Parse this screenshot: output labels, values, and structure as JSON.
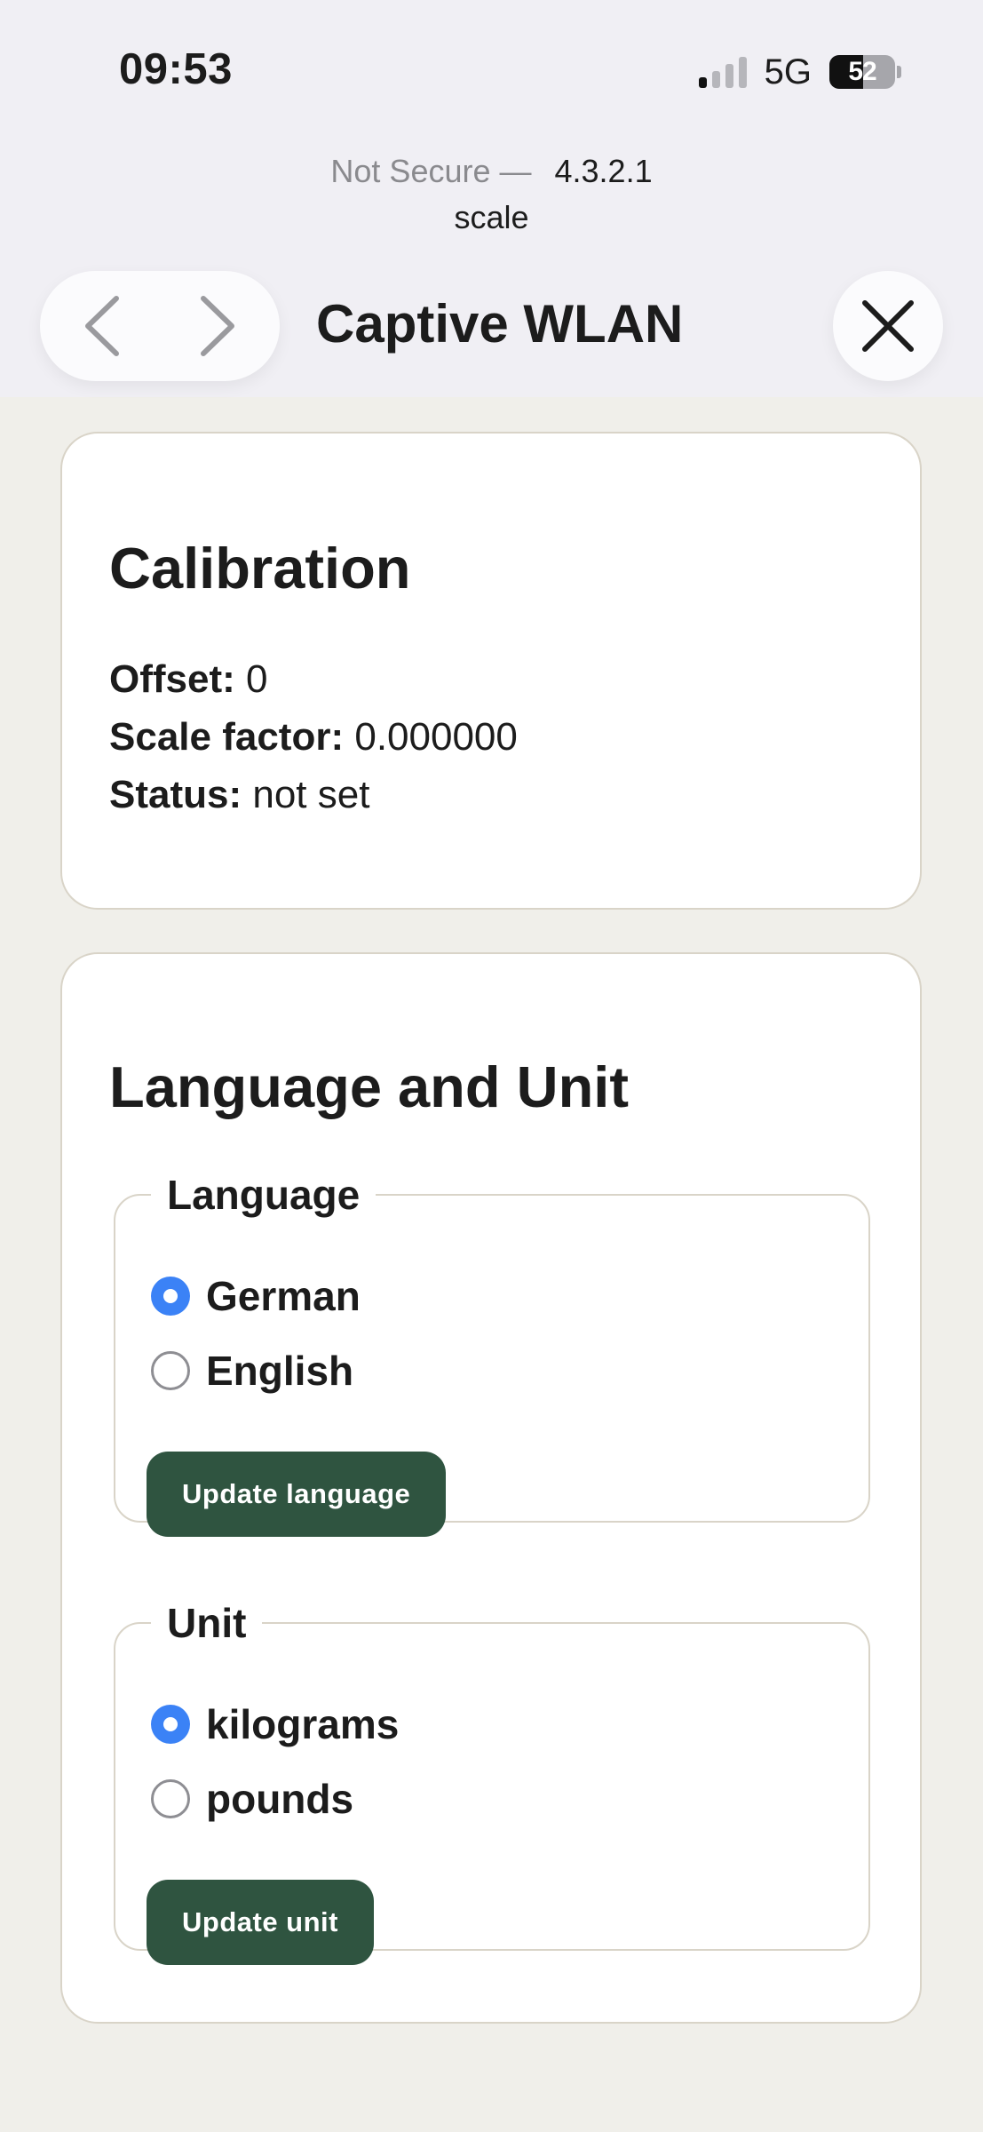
{
  "status_bar": {
    "time": "09:53",
    "network": "5G",
    "battery": "52"
  },
  "browser": {
    "security_label": "Not Secure —",
    "host": "4.3.2.1",
    "path": "scale",
    "title": "Captive WLAN"
  },
  "calibration": {
    "heading": "Calibration",
    "offset_label": "Offset:",
    "offset_value": "0",
    "scale_label": "Scale factor:",
    "scale_value": "0.000000",
    "status_label": "Status:",
    "status_value": "not set"
  },
  "language_unit": {
    "heading": "Language and Unit",
    "language": {
      "legend": "Language",
      "options": [
        {
          "label": "German",
          "checked": true
        },
        {
          "label": "English",
          "checked": false
        }
      ],
      "button": "Update language"
    },
    "unit": {
      "legend": "Unit",
      "options": [
        {
          "label": "kilograms",
          "checked": true
        },
        {
          "label": "pounds",
          "checked": false
        }
      ],
      "button": "Update unit"
    }
  },
  "colors": {
    "accent": "#3b82f6",
    "button": "#2f5440"
  }
}
